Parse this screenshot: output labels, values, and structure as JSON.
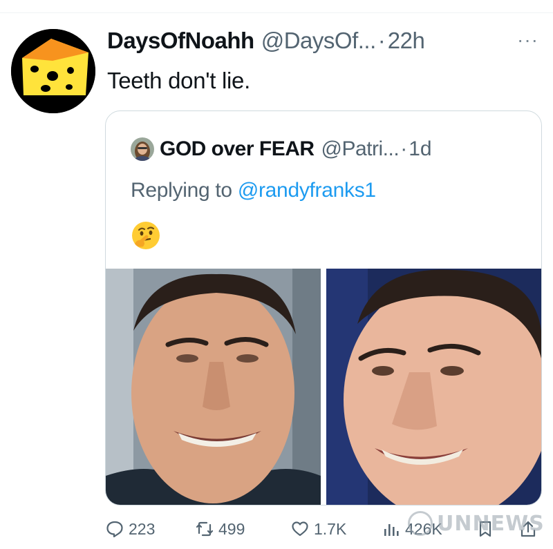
{
  "tweet": {
    "display_name": "DaysOfNoahh",
    "handle": "@DaysOf...",
    "separator": "·",
    "time": "22h",
    "more": "···",
    "text": "Teeth don't lie."
  },
  "quoted": {
    "display_name": "GOD over FEAR",
    "handle": "@Patri...",
    "separator": "·",
    "time": "1d",
    "replying_prefix": "Replying to ",
    "replying_to": "@randyfranks1",
    "emoji": "thinking-face"
  },
  "actions": {
    "replies": "223",
    "retweets": "499",
    "likes": "1.7K",
    "views": "426K"
  },
  "watermark": "UNNEWS",
  "colors": {
    "accent": "#1d9bf0",
    "muted": "#536471",
    "border": "#cfd9de",
    "avatar_yellow": "#ffe33b"
  }
}
